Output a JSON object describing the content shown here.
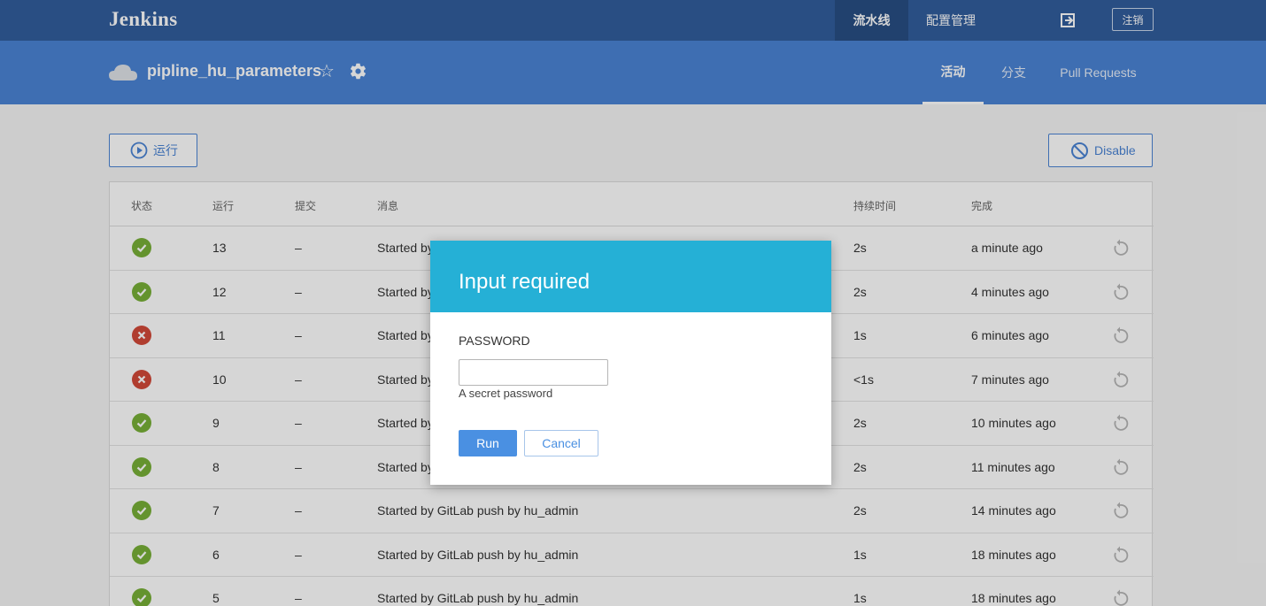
{
  "header": {
    "brand": "Jenkins",
    "nav": [
      {
        "label": "流水线",
        "active": true
      },
      {
        "label": "配置管理",
        "active": false
      }
    ],
    "logout_icon": "logout-icon",
    "logout_label": "注销"
  },
  "subheader": {
    "pipeline_name": "pipline_hu_parameters",
    "star_glyph": "☆",
    "tabs": [
      {
        "label": "活动",
        "active": true
      },
      {
        "label": "分支",
        "active": false
      },
      {
        "label": "Pull Requests",
        "active": false
      }
    ]
  },
  "toolbar": {
    "run_label": "运行",
    "disable_label": "Disable"
  },
  "table": {
    "headers": [
      "状态",
      "运行",
      "提交",
      "消息",
      "持续时间",
      "完成"
    ],
    "rows": [
      {
        "status": "success",
        "run": "13",
        "commit": "–",
        "message": "Started by",
        "duration": "2s",
        "completed": "a minute ago"
      },
      {
        "status": "success",
        "run": "12",
        "commit": "–",
        "message": "Started by",
        "duration": "2s",
        "completed": "4 minutes ago"
      },
      {
        "status": "failure",
        "run": "11",
        "commit": "–",
        "message": "Started by",
        "duration": "1s",
        "completed": "6 minutes ago"
      },
      {
        "status": "failure",
        "run": "10",
        "commit": "–",
        "message": "Started by",
        "duration": "<1s",
        "completed": "7 minutes ago"
      },
      {
        "status": "success",
        "run": "9",
        "commit": "–",
        "message": "Started by",
        "duration": "2s",
        "completed": "10 minutes ago"
      },
      {
        "status": "success",
        "run": "8",
        "commit": "–",
        "message": "Started by",
        "duration": "2s",
        "completed": "11 minutes ago"
      },
      {
        "status": "success",
        "run": "7",
        "commit": "–",
        "message": "Started by GitLab push by hu_admin",
        "duration": "2s",
        "completed": "14 minutes ago"
      },
      {
        "status": "success",
        "run": "6",
        "commit": "–",
        "message": "Started by GitLab push by hu_admin",
        "duration": "1s",
        "completed": "18 minutes ago"
      },
      {
        "status": "success",
        "run": "5",
        "commit": "–",
        "message": "Started by GitLab push by hu_admin",
        "duration": "1s",
        "completed": "18 minutes ago"
      }
    ]
  },
  "modal": {
    "title": "Input required",
    "field_label": "PASSWORD",
    "field_value": "",
    "field_help": "A secret password",
    "run_label": "Run",
    "cancel_label": "Cancel"
  },
  "colors": {
    "top_header": "#325d9c",
    "sub_header": "#4a84d4",
    "modal_header": "#25b0d6",
    "success": "#78b037",
    "failure": "#d24939",
    "primary_button": "#4a90e2"
  }
}
